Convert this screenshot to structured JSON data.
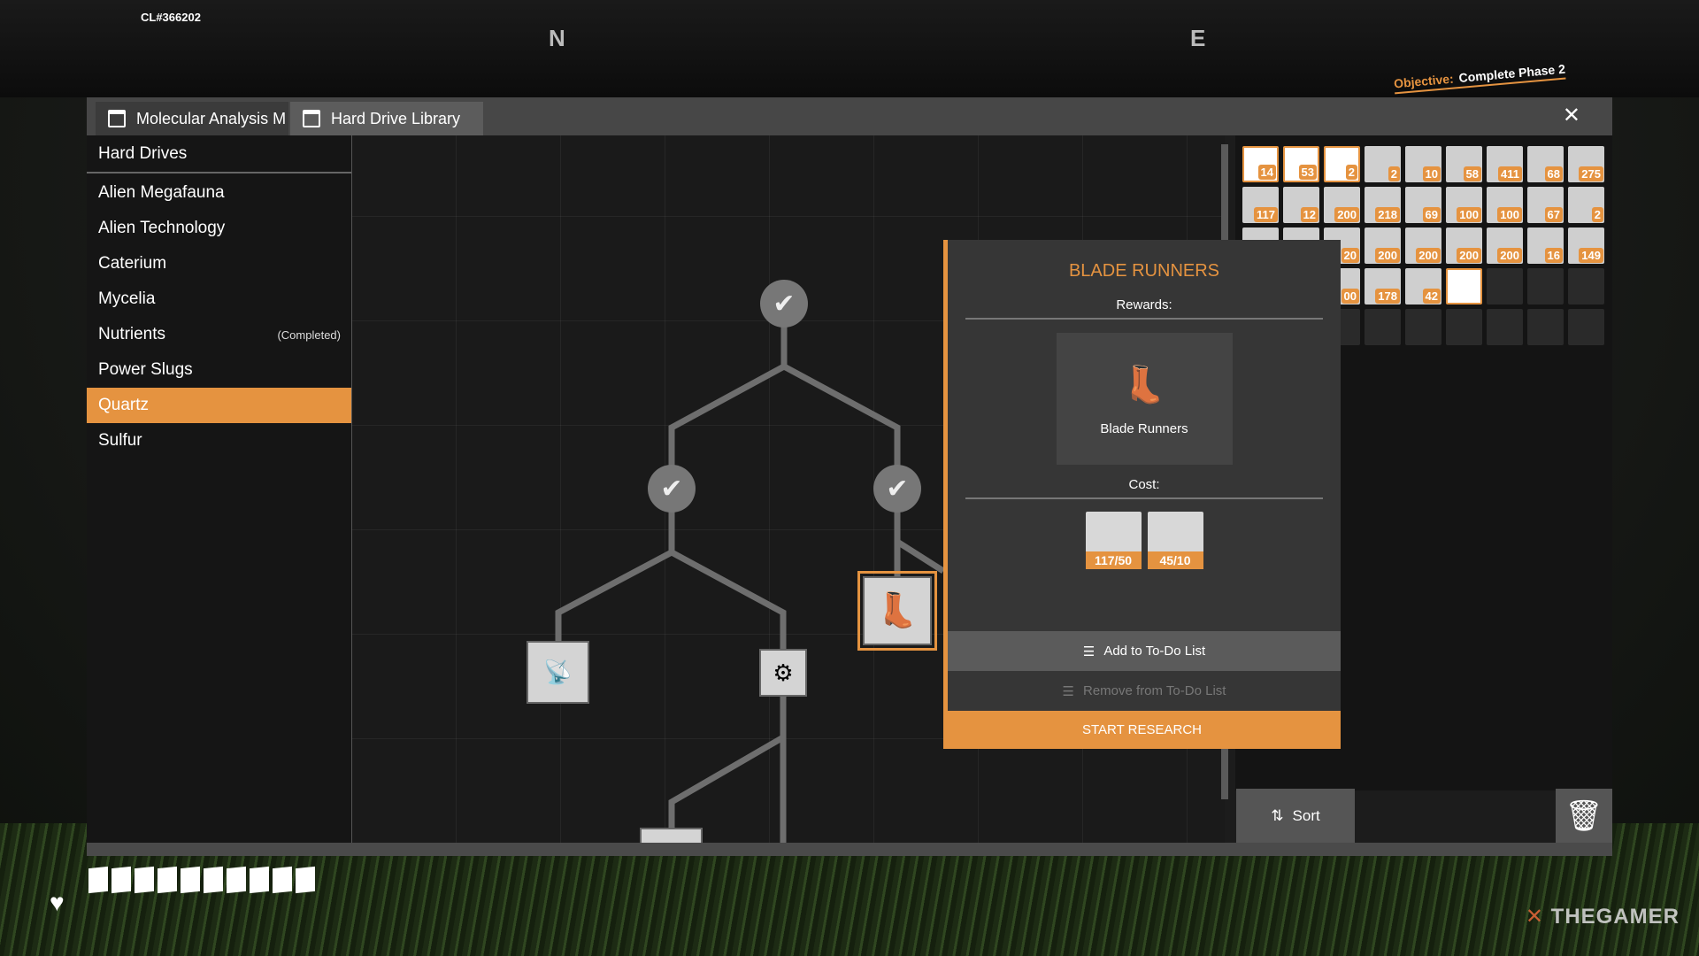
{
  "hud": {
    "build": "CL#366202",
    "compass": [
      "N",
      "E"
    ],
    "objective_label": "Objective:",
    "objective": "Complete Phase 2",
    "health_segments": 10,
    "watermark": "THEGAMER"
  },
  "window": {
    "tabs": [
      {
        "label": "Molecular Analysis M",
        "icon": "window-icon"
      },
      {
        "label": "Hard Drive Library",
        "icon": "window-icon",
        "active": true
      }
    ],
    "close_icon": "close-icon"
  },
  "sidebar": {
    "header": "Hard Drives",
    "items": [
      {
        "label": "Alien Megafauna",
        "status": ""
      },
      {
        "label": "Alien Technology",
        "status": ""
      },
      {
        "label": "Caterium",
        "status": ""
      },
      {
        "label": "Mycelia",
        "status": ""
      },
      {
        "label": "Nutrients",
        "status": "(Completed)"
      },
      {
        "label": "Power Slugs",
        "status": ""
      },
      {
        "label": "Quartz",
        "status": "",
        "selected": true
      },
      {
        "label": "Sulfur",
        "status": ""
      }
    ]
  },
  "inventory": {
    "rows": [
      [
        {
          "c": "14",
          "hl": true
        },
        {
          "c": "53",
          "hl": true
        },
        {
          "c": "2",
          "hl": true
        },
        {
          "c": "2"
        },
        {
          "c": "10"
        },
        {
          "c": "58"
        },
        {
          "c": "411"
        },
        {
          "c": "68"
        },
        {
          "c": "275"
        }
      ],
      [
        {
          "c": "117"
        },
        {
          "c": "12"
        },
        {
          "c": "200"
        },
        {
          "c": "218"
        },
        {
          "c": "69"
        },
        {
          "c": "100"
        },
        {
          "c": "100"
        },
        {
          "c": "67"
        },
        {
          "c": "2"
        }
      ],
      [
        {
          "c": ""
        },
        {
          "c": ""
        },
        {
          "c": "20"
        },
        {
          "c": "200"
        },
        {
          "c": "200"
        },
        {
          "c": "200"
        },
        {
          "c": "200"
        },
        {
          "c": "16"
        },
        {
          "c": "149"
        }
      ],
      [
        {
          "c": ""
        },
        {
          "c": ""
        },
        {
          "c": "00"
        },
        {
          "c": "178"
        },
        {
          "c": "42"
        },
        {
          "c": "",
          "hl": true
        },
        {
          "empty": true
        },
        {
          "empty": true
        },
        {
          "empty": true
        }
      ],
      [
        {
          "empty": true
        },
        {
          "empty": true
        },
        {
          "empty": true
        },
        {
          "empty": true
        },
        {
          "empty": true
        },
        {
          "empty": true
        },
        {
          "empty": true
        },
        {
          "empty": true
        },
        {
          "empty": true
        }
      ]
    ],
    "sort_label": "Sort",
    "trash_icon": "trash-icon"
  },
  "detail": {
    "title": "BLADE RUNNERS",
    "rewards_label": "Rewards:",
    "reward_name": "Blade Runners",
    "cost_label": "Cost:",
    "costs": [
      {
        "count": "117/50",
        "icon": "silica-icon"
      },
      {
        "count": "45/10",
        "icon": "modular-frame-icon"
      }
    ],
    "add_todo": "Add to To-Do List",
    "remove_todo": "Remove from To-Do List",
    "start": "START RESEARCH"
  },
  "colors": {
    "accent": "#e59340",
    "panel": "#363636"
  }
}
